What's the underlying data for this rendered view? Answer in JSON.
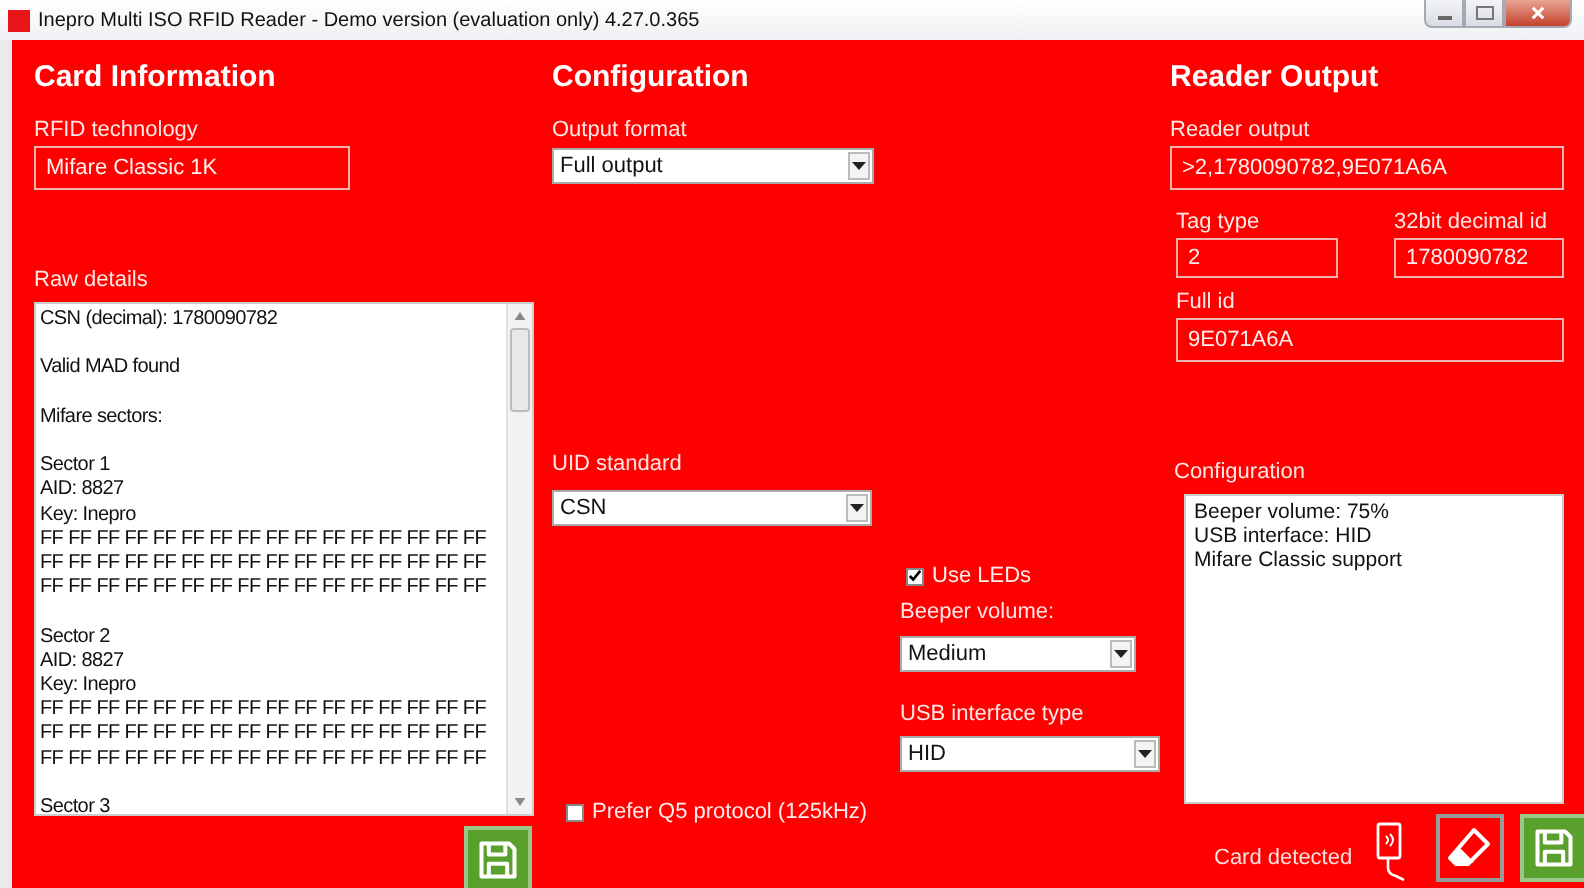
{
  "window": {
    "title": "Inepro Multi ISO RFID Reader - Demo version (evaluation only) 4.27.0.365"
  },
  "card_information": {
    "heading": "Card Information",
    "rfid_technology": {
      "label": "RFID technology",
      "value": "Mifare Classic 1K"
    },
    "raw_details": {
      "label": "Raw details",
      "blocks": [
        [
          "CSN (decimal): 1780090782"
        ],
        [
          "Valid MAD found"
        ],
        [
          "Mifare sectors:"
        ],
        [
          "Sector 1",
          "AID: 8827",
          "Key: Inepro",
          "FF FF FF FF FF FF FF FF FF FF FF FF FF FF FF FF",
          "FF FF FF FF FF FF FF FF FF FF FF FF FF FF FF FF",
          "FF FF FF FF FF FF FF FF FF FF FF FF FF FF FF FF"
        ],
        [
          "Sector 2",
          "AID: 8827",
          "Key: Inepro",
          "FF FF FF FF FF FF FF FF FF FF FF FF FF FF FF FF",
          "FF FF FF FF FF FF FF FF FF FF FF FF FF FF FF FF",
          "FF FF FF FF FF FF FF FF FF FF FF FF FF FF FF FF"
        ],
        [
          "Sector 3"
        ]
      ]
    }
  },
  "configuration": {
    "heading": "Configuration",
    "output_format": {
      "label": "Output format",
      "value": "Full output"
    },
    "uid_standard": {
      "label": "UID standard",
      "value": "CSN"
    },
    "use_leds": {
      "label": "Use LEDs",
      "checked": true
    },
    "beeper_volume": {
      "label": "Beeper volume:",
      "value": "Medium"
    },
    "usb_interface_type": {
      "label": "USB interface type",
      "value": "HID"
    },
    "prefer_q5": {
      "label": "Prefer Q5 protocol (125kHz)",
      "checked": false
    }
  },
  "reader_output": {
    "heading": "Reader Output",
    "reader_output": {
      "label": "Reader output",
      "value": ">2,1780090782,9E071A6A"
    },
    "tag_type": {
      "label": "Tag type",
      "value": "2"
    },
    "decimal_id": {
      "label": "32bit decimal id",
      "value": "1780090782"
    },
    "full_id": {
      "label": "Full id",
      "value": "9E071A6A"
    },
    "configuration": {
      "label": "Configuration",
      "lines": [
        "Beeper volume: 75%",
        "USB interface: HID",
        "Mifare Classic support"
      ]
    },
    "status": "Card detected"
  }
}
